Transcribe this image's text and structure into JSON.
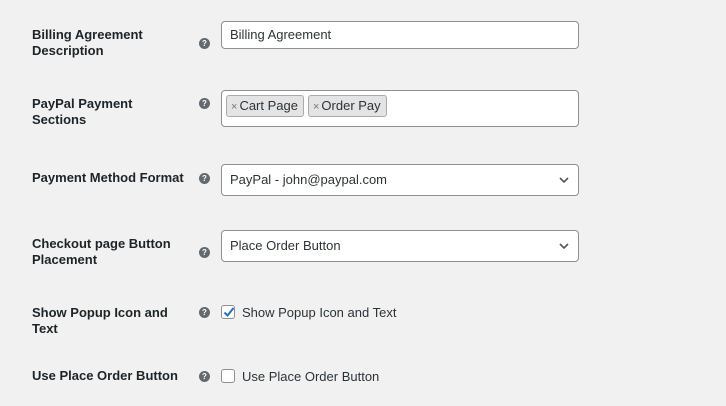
{
  "fields": {
    "billing_agreement": {
      "label": "Billing Agreement Description",
      "value": "Billing Agreement",
      "help_icon": "question-circle-icon"
    },
    "paypal_sections": {
      "label": "PayPal Payment Sections",
      "tags": [
        "Cart Page",
        "Order Pay"
      ],
      "remove_glyph": "×",
      "help_icon": "question-circle-icon"
    },
    "payment_method_format": {
      "label": "Payment Method Format",
      "value": "PayPal - john@paypal.com",
      "help_icon": "question-circle-icon"
    },
    "button_placement": {
      "label": "Checkout page Button Placement",
      "value": "Place Order Button",
      "help_icon": "question-circle-icon"
    },
    "show_popup": {
      "label": "Show Popup Icon and Text",
      "checkbox_label": "Show Popup Icon and Text",
      "checked": true,
      "help_icon": "question-circle-icon"
    },
    "use_place_order": {
      "label": "Use Place Order Button",
      "checkbox_label": "Use Place Order Button",
      "checked": false,
      "help_icon": "question-circle-icon"
    }
  },
  "help_glyph": "?",
  "colors": {
    "accent": "#2271b1",
    "help_bg": "#646970",
    "border": "#8c8f94",
    "tag_bg": "#e4e4e4"
  }
}
